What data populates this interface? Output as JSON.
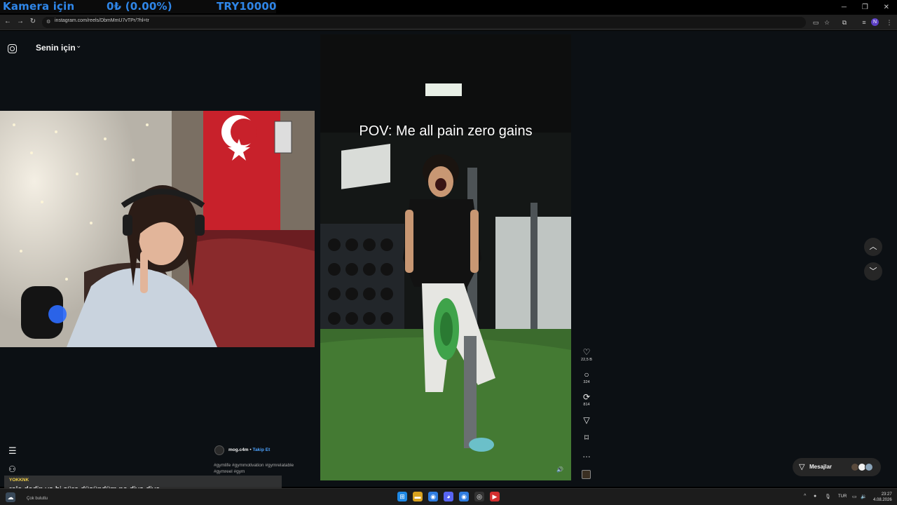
{
  "stream_overlay": {
    "label": "Kamera için",
    "value": "0₺ (0.00%)",
    "goal": "TRY10000"
  },
  "browser": {
    "url": "instagram.com/reels/DbmMmU7vTPr/?hl=tr",
    "profile_initial": "N"
  },
  "instagram": {
    "feed_title": "Senin için",
    "reel": {
      "caption_overlay": "POV: Me all pain zero gains",
      "author": "mog.c4m",
      "follow_label": "Takip Et",
      "hashtags": "#gymlife #gymmotivation #gymrelatable #gymreel #gym",
      "counts": {
        "likes": "22,5 B",
        "comments": "324",
        "reposts": "814"
      }
    },
    "messages_label": "Mesajlar"
  },
  "chat": {
    "username": "YOKKNK",
    "message": "rele dedin ya bi süre düşündüm ne diyo diye"
  },
  "taskbar": {
    "weather": "Çok bulutlu",
    "language": "TUR",
    "time": "23:27",
    "date": "4.08.2026"
  },
  "colors": {
    "overlay_text": "#2f86e8",
    "ig_background": "#0c1014",
    "follow_link": "#4da3ff",
    "chat_username": "#f6d34a"
  }
}
